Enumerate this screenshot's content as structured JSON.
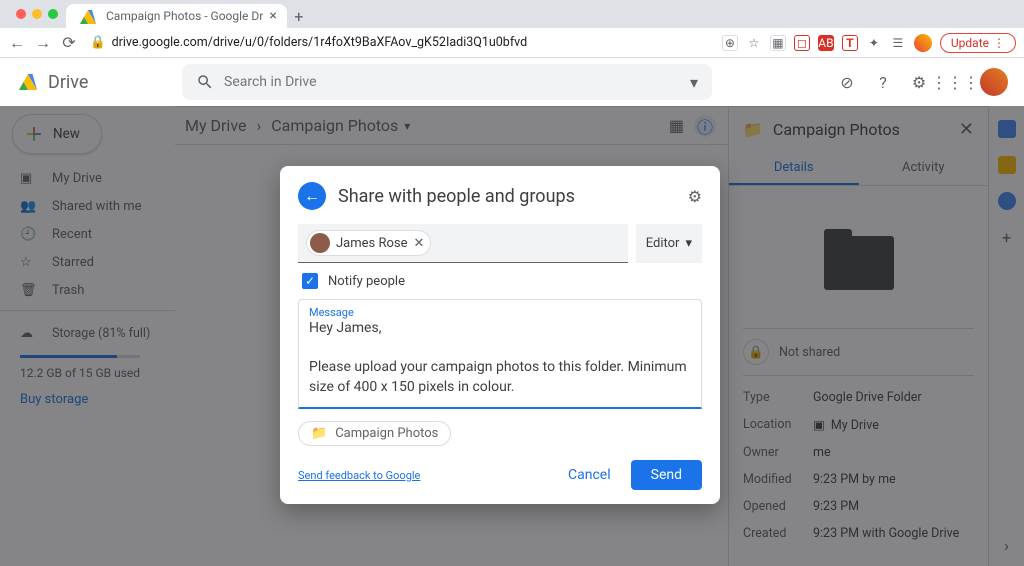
{
  "browser": {
    "tab_title": "Campaign Photos - Google Dr",
    "url": "drive.google.com/drive/u/0/folders/1r4foXt9BaXFAov_gK52Iadi3Q1u0bfvd",
    "update_label": "Update"
  },
  "drive": {
    "product": "Drive",
    "search_placeholder": "Search in Drive",
    "new_button": "New",
    "nav": {
      "my_drive": "My Drive",
      "shared": "Shared with me",
      "recent": "Recent",
      "starred": "Starred",
      "trash": "Trash"
    },
    "storage": {
      "label": "Storage (81% full)",
      "used": "12.2 GB of 15 GB used",
      "buy": "Buy storage"
    }
  },
  "breadcrumb": {
    "root": "My Drive",
    "current": "Campaign Photos"
  },
  "details": {
    "title": "Campaign Photos",
    "tab_details": "Details",
    "tab_activity": "Activity",
    "share_status": "Not shared",
    "rows": {
      "type_k": "Type",
      "type_v": "Google Drive Folder",
      "location_k": "Location",
      "location_v": "My Drive",
      "owner_k": "Owner",
      "owner_v": "me",
      "modified_k": "Modified",
      "modified_v": "9:23 PM by me",
      "opened_k": "Opened",
      "opened_v": "9:23 PM",
      "created_k": "Created",
      "created_v": "9:23 PM with Google Drive"
    }
  },
  "dialog": {
    "title": "Share with people and groups",
    "person": "James Rose",
    "role": "Editor",
    "notify": "Notify people",
    "message_label": "Message",
    "message": "Hey James,\n\nPlease upload your campaign photos to this folder. Minimum size of 400 x 150 pixels in colour.",
    "attachment": "Campaign Photos",
    "feedback": "Send feedback to Google",
    "cancel": "Cancel",
    "send": "Send"
  }
}
